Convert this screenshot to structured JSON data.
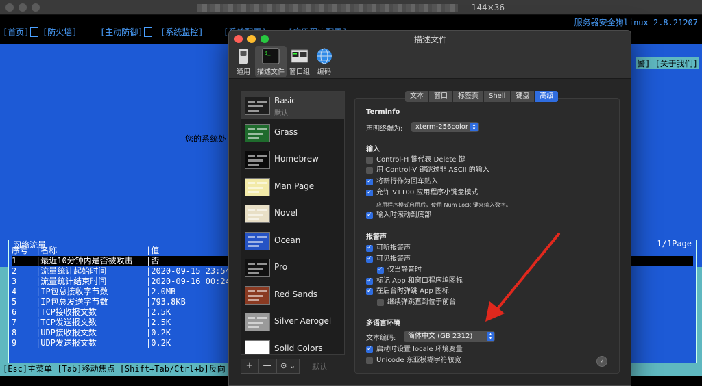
{
  "terminal": {
    "window_title": "— 144×36",
    "brand": "服务器安全狗linux 2.8.21207",
    "menu": {
      "home": "[首页]",
      "firewall": "[防火墙]",
      "active_defense": "[主动防御]",
      "monitor": "[系统监控]",
      "config": "[系统配置]",
      "app_config": "[应用程序配置]"
    },
    "right_menu": "警] [关于我们]",
    "status_message": "您的系统处",
    "traffic": {
      "title": "网络流量",
      "page": "1/1Page",
      "header": [
        "序号",
        "|名称",
        "|值"
      ],
      "rows": [
        [
          "1",
          "|最近10分钟内是否被攻击",
          "|否"
        ],
        [
          "2",
          "|流量统计起始时间",
          "|2020-09-15 23:54:"
        ],
        [
          "3",
          "|流量统计结束时间",
          "|2020-09-16 00:24:"
        ],
        [
          "4",
          "|IP包总接收字节数",
          "|2.0MB"
        ],
        [
          "5",
          "|IP包总发送字节数",
          "|793.8KB"
        ],
        [
          "6",
          "|TCP接收报文数",
          "|2.5K"
        ],
        [
          "7",
          "|TCP发送报文数",
          "|2.5K"
        ],
        [
          "8",
          "|UDP接收报文数",
          "|0.2K"
        ],
        [
          "9",
          "|UDP发送报文数",
          "|0.2K"
        ]
      ]
    },
    "footer": "[Esc]主菜单 [Tab]移动焦点 [Shift+Tab/Ctrl+b]反向"
  },
  "prefs": {
    "title": "描述文件",
    "toolbar": {
      "general": "通用",
      "profiles": "描述文件",
      "window_groups": "窗口组",
      "encodings": "编码"
    },
    "profiles": [
      {
        "name": "Basic",
        "sub": "默认",
        "color": "#1e1e1e"
      },
      {
        "name": "Grass",
        "sub": "",
        "color": "#1f6b2d"
      },
      {
        "name": "Homebrew",
        "sub": "",
        "color": "#0a0a0a"
      },
      {
        "name": "Man Page",
        "sub": "",
        "color": "#f2eaa8"
      },
      {
        "name": "Novel",
        "sub": "",
        "color": "#e8dfc6"
      },
      {
        "name": "Ocean",
        "sub": "",
        "color": "#2553c4"
      },
      {
        "name": "Pro",
        "sub": "",
        "color": "#111111"
      },
      {
        "name": "Red Sands",
        "sub": "",
        "color": "#8a3a22"
      },
      {
        "name": "Silver Aerogel",
        "sub": "",
        "color": "#9a9a9a"
      },
      {
        "name": "Solid Colors",
        "sub": "",
        "color": "#ffffff"
      }
    ],
    "list_controls": {
      "add": "+",
      "remove": "—",
      "gear": "⚙ ⌄",
      "default": "默认"
    },
    "tabs": [
      "文本",
      "窗口",
      "标签页",
      "Shell",
      "键盘",
      "高级"
    ],
    "active_tab": "高级",
    "terminfo": {
      "heading": "Terminfo",
      "declare_label": "声明终端为:",
      "declare_value": "xterm-256color"
    },
    "input": {
      "heading": "输入",
      "items": [
        {
          "label": "Control-H 键代表 Delete 键",
          "checked": false
        },
        {
          "label": "用 Control-V 键跳过非 ASCII 的输入",
          "checked": false
        },
        {
          "label": "将新行作为回车贴入",
          "checked": true
        },
        {
          "label": "允许 VT100 应用程序小键盘模式",
          "checked": true
        }
      ],
      "note": "应用程序模式启用后，使用 Num Lock 键来输入数字。",
      "scroll_item": {
        "label": "输入时滚动到底部",
        "checked": true
      }
    },
    "bell": {
      "heading": "报警声",
      "items": [
        {
          "label": "可听报警声",
          "checked": true
        },
        {
          "label": "可见报警声",
          "checked": true
        },
        {
          "label": "仅当静音时",
          "checked": true
        },
        {
          "label": "标记 App 和窗口程序坞图标",
          "checked": true
        },
        {
          "label": "在后台时弹跳 App 图标",
          "checked": true
        },
        {
          "label": "继续弹跳直到位于前台",
          "checked": false
        }
      ]
    },
    "locale": {
      "heading": "多语言环境",
      "encoding_label": "文本编码:",
      "encoding_value": "简体中文 (GB 2312)",
      "items": [
        {
          "label": "启动时设置 locale 环境变量",
          "checked": true
        },
        {
          "label": "Unicode 东亚模糊字符较宽",
          "checked": false
        }
      ]
    },
    "help": "?"
  },
  "colors": {
    "accent": "#2f6de0",
    "terminal_blue": "#1d5ad6",
    "terminal_cyan": "#5fb8c0",
    "annotation_red": "#e0281d"
  }
}
